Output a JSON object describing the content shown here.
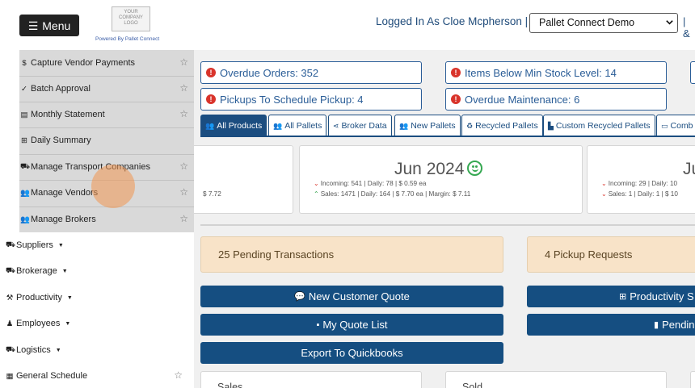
{
  "header": {
    "menu_label": "Menu",
    "logo_text": "YOUR COMPANY LOGO",
    "powered_by": "Powered By Pallet Connect",
    "logged_in_text": "Logged In As Cloe Mcpherson",
    "separator": "|",
    "company_selected": "Pallet Connect Demo",
    "trailing_text": "| &"
  },
  "sidebar": {
    "sub_items": [
      {
        "icon": "dollar-icon",
        "glyph": "$",
        "label": "Capture Vendor Payments",
        "starred": true
      },
      {
        "icon": "check-icon",
        "glyph": "✓",
        "label": "Batch Approval",
        "starred": true
      },
      {
        "icon": "statement-icon",
        "glyph": "▤",
        "label": "Monthly Statement",
        "starred": true
      },
      {
        "icon": "table-icon",
        "glyph": "⊞",
        "label": "Daily Summary",
        "starred": false
      },
      {
        "icon": "truck-icon",
        "glyph": "⛟",
        "label": "Manage Transport Companies",
        "starred": true
      },
      {
        "icon": "users-icon",
        "glyph": "👥",
        "label": "Manage Vendors",
        "starred": true
      },
      {
        "icon": "users-icon",
        "glyph": "👥",
        "label": "Manage Brokers",
        "starred": true
      }
    ],
    "main_items": [
      {
        "icon": "supplier-truck-icon",
        "glyph": "⛟",
        "label": "Suppliers",
        "dropdown": true,
        "starred": false
      },
      {
        "icon": "truck-icon",
        "glyph": "⛟",
        "label": "Brokerage",
        "dropdown": true,
        "starred": false
      },
      {
        "icon": "hammer-icon",
        "glyph": "⚒",
        "label": "Productivity",
        "dropdown": true,
        "starred": false
      },
      {
        "icon": "person-icon",
        "glyph": "♟",
        "label": "Employees",
        "dropdown": true,
        "starred": false
      },
      {
        "icon": "truck-icon",
        "glyph": "⛟",
        "label": "Logistics",
        "dropdown": true,
        "starred": false
      },
      {
        "icon": "calendar-icon",
        "glyph": "▦",
        "label": "General Schedule",
        "dropdown": false,
        "starred": true
      }
    ]
  },
  "alerts": [
    {
      "label": "Overdue Orders: 352"
    },
    {
      "label": "Items Below Min Stock Level: 14"
    },
    {
      "label": "Pickups To Schedule Pickup: 4"
    },
    {
      "label": "Overdue Maintenance: 6"
    }
  ],
  "tabs": [
    {
      "label": "All Products",
      "glyph": "👥",
      "active": true
    },
    {
      "label": "All Pallets",
      "glyph": "👥",
      "active": false
    },
    {
      "label": "Broker Data",
      "glyph": "⋖",
      "active": false
    },
    {
      "label": "New Pallets",
      "glyph": "👥",
      "active": false
    },
    {
      "label": "Recycled Pallets",
      "glyph": "♻",
      "active": false
    },
    {
      "label": "Custom Recycled Pallets",
      "glyph": "▙",
      "active": false
    },
    {
      "label": "Comb",
      "glyph": "▭",
      "active": false
    }
  ],
  "cards": {
    "left": {
      "partial_symbol": ")",
      "partial_value": "$ 7.72"
    },
    "center": {
      "month": "Jun 2024",
      "incoming": "Incoming: 541 | Daily: 78 | $ 0.59 ea",
      "sales": "Sales: 1471 | Daily: 164 | $ 7.70 ea | Margin: $ 7.11"
    },
    "right": {
      "month_partial": "Ju",
      "incoming": "Incoming: 29 | Daily: 10",
      "sales": "Sales: 1 | Daily: 1 | $ 10"
    }
  },
  "pending": {
    "transactions": "25 Pending Transactions",
    "pickups": "4 Pickup Requests"
  },
  "buttons": {
    "new_quote": "New Customer Quote",
    "quote_list": "My Quote List",
    "export": "Export To Quickbooks",
    "productivity": "Productivity S",
    "pending": "Pendin"
  },
  "stats": {
    "sales": "Sales",
    "sold": "Sold"
  },
  "colors": {
    "primary": "#154e81",
    "alert_red": "#d9342b",
    "pending_bg": "#f8e3c8",
    "sidebar_sub_bg": "#d9d9d9"
  }
}
